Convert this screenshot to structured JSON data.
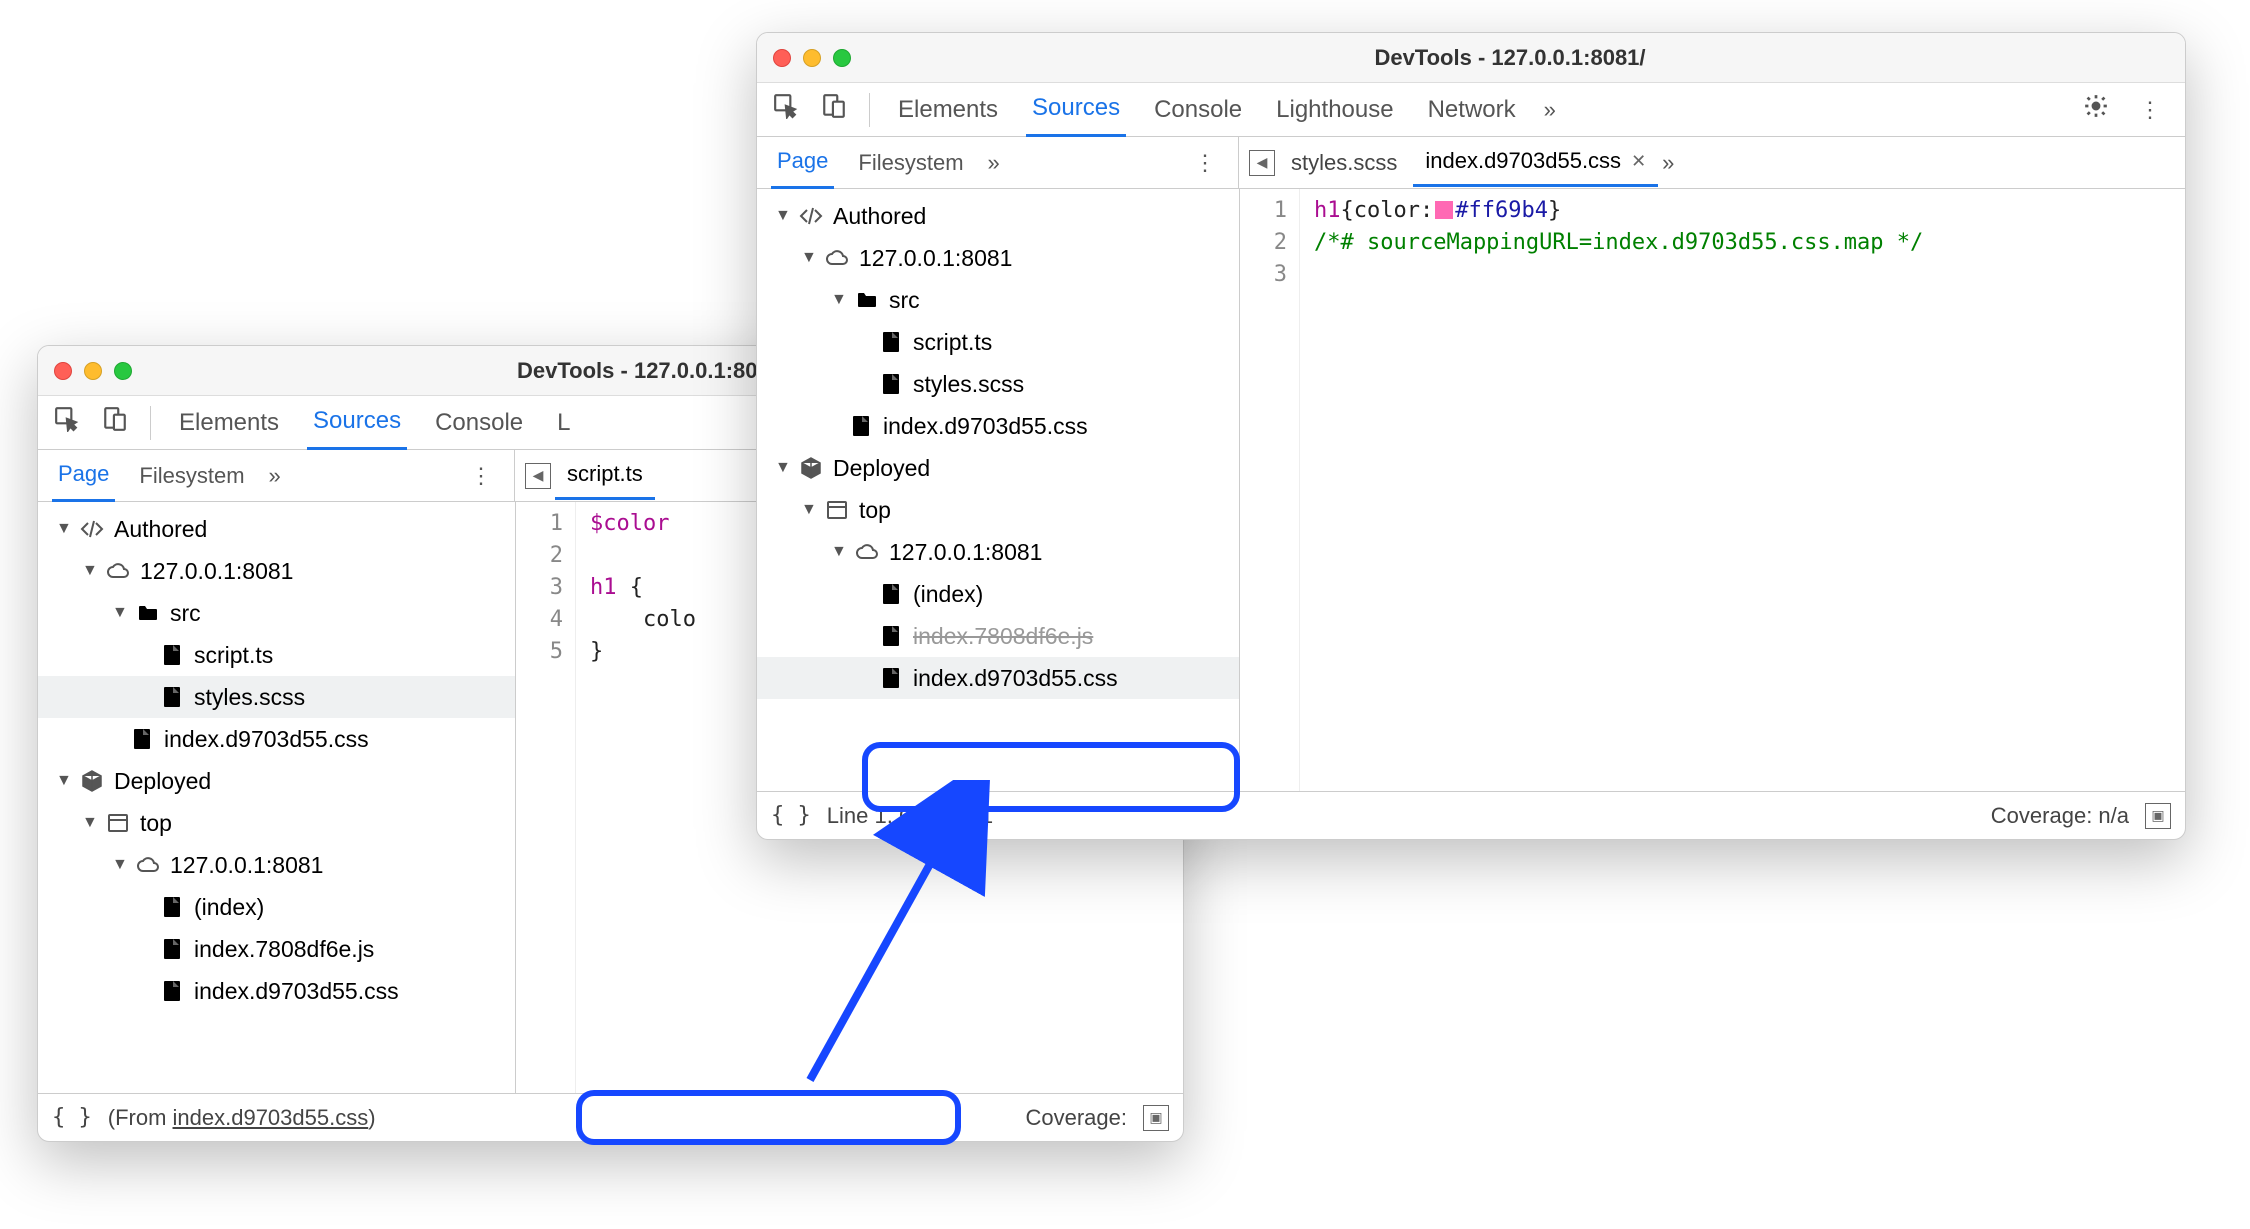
{
  "win1": {
    "title": "DevTools - 127.0.0.1:8081",
    "tabs": {
      "elements": "Elements",
      "sources": "Sources",
      "console": "Console",
      "last_trunc": "L"
    },
    "navtabs": {
      "page": "Page",
      "filesystem": "Filesystem"
    },
    "filetab": {
      "name": "script.ts"
    },
    "tree": {
      "authored": "Authored",
      "host": "127.0.0.1:8081",
      "src": "src",
      "script": "script.ts",
      "styles": "styles.scss",
      "indexcss": "index.d9703d55.css",
      "deployed": "Deployed",
      "top": "top",
      "host2": "127.0.0.1:8081",
      "index": "(index)",
      "indexjs": "index.7808df6e.js",
      "indexcss2": "index.d9703d55.css"
    },
    "code": {
      "l1": "$color",
      "l2": "",
      "l3a": "h1",
      "l3b": " {",
      "l4": "    colo",
      "l5": "}"
    },
    "status": {
      "from_prefix": "(From ",
      "from_file": "index.d9703d55.css",
      "from_suffix": ")",
      "coverage_label": "Coverage:"
    }
  },
  "win2": {
    "title": "DevTools - 127.0.0.1:8081/",
    "tabs": {
      "elements": "Elements",
      "sources": "Sources",
      "console": "Console",
      "lighthouse": "Lighthouse",
      "network": "Network"
    },
    "navtabs": {
      "page": "Page",
      "filesystem": "Filesystem"
    },
    "filetabs": {
      "styles": "styles.scss",
      "indexcss": "index.d9703d55.css"
    },
    "tree": {
      "authored": "Authored",
      "host": "127.0.0.1:8081",
      "src": "src",
      "script": "script.ts",
      "styles": "styles.scss",
      "indexcss": "index.d9703d55.css",
      "deployed": "Deployed",
      "top": "top",
      "host2": "127.0.0.1:8081",
      "index": "(index)",
      "indexjs_trunc": "index.7808df6e.js",
      "indexcss2": "index.d9703d55.css"
    },
    "code": {
      "sel": "h1",
      "open": "{",
      "prop": "color",
      "colon": ":",
      "hex": "#ff69b4",
      "close": "}",
      "comment": "/*# sourceMappingURL=index.d9703d55.css.map */"
    },
    "status": {
      "pos": "Line 1, Column 1",
      "coverage": "Coverage: n/a"
    }
  }
}
